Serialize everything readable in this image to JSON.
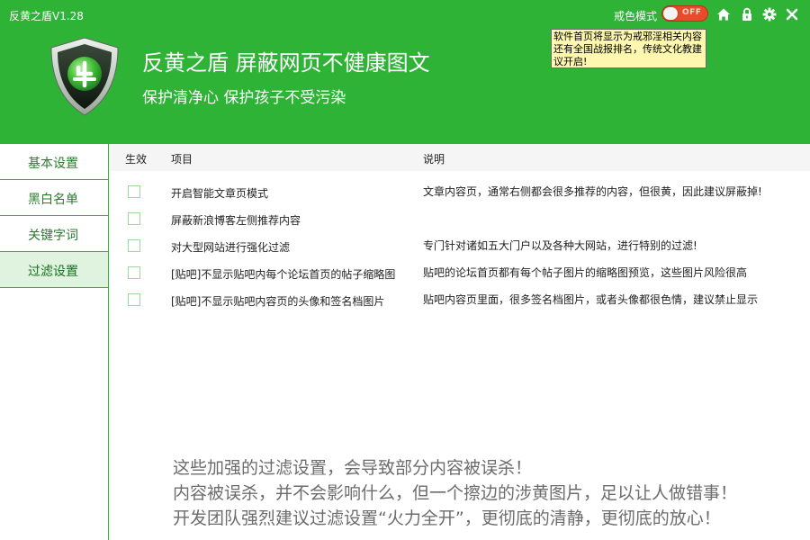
{
  "window": {
    "title": "反黄之盾V1.28"
  },
  "header": {
    "mode_label": "戒色模式",
    "toggle_text": "OFF",
    "headline": "反黄之盾 屏蔽网页不健康图文",
    "subline": "保护清净心 保护孩子不受污染",
    "notice": "软件首页将显示为戒邪淫相关内容还有全国战报排名，传统文化教建议开启!",
    "icons": [
      "home-icon",
      "lock-icon",
      "gear-icon",
      "close-icon"
    ],
    "colors": {
      "brand": "#2eb336",
      "toggle_off": "#e84b2a",
      "notice_bg": "#fdf7b0"
    }
  },
  "sidebar": {
    "items": [
      {
        "label": "基本设置",
        "active": false
      },
      {
        "label": "黑白名单",
        "active": false
      },
      {
        "label": "关键字词",
        "active": false
      },
      {
        "label": "过滤设置",
        "active": true
      }
    ]
  },
  "table": {
    "columns": [
      "生效",
      "项目",
      "说明"
    ],
    "rows": [
      {
        "checked": false,
        "item": "开启智能文章页模式",
        "desc": "文章内容页，通常右侧都会很多推荐的内容，但很黄，因此建议屏蔽掉!"
      },
      {
        "checked": false,
        "item": "屏蔽新浪博客左侧推荐内容",
        "desc": ""
      },
      {
        "checked": false,
        "item": "对大型网站进行强化过滤",
        "desc": "专门针对诸如五大门户以及各种大网站，进行特别的过滤!"
      },
      {
        "checked": false,
        "item": "[贴吧]不显示贴吧内每个论坛首页的帖子缩略图",
        "desc": "贴吧的论坛首页都有每个帖子图片的缩略图预览，这些图片风险很高"
      },
      {
        "checked": false,
        "item": "[贴吧]不显示贴吧内容页的头像和签名档图片",
        "desc": "贴吧内容页里面，很多签名档图片，或者头像都很色情，建议禁止显示"
      }
    ]
  },
  "warning": {
    "lines": [
      "这些加强的过滤设置，会导致部分内容被误杀！",
      "内容被误杀，并不会影响什么，但一个擦边的涉黄图片，足以让人做错事！",
      "开发团队强烈建议过滤设置“火力全开”，更彻底的清静，更彻底的放心！"
    ]
  }
}
